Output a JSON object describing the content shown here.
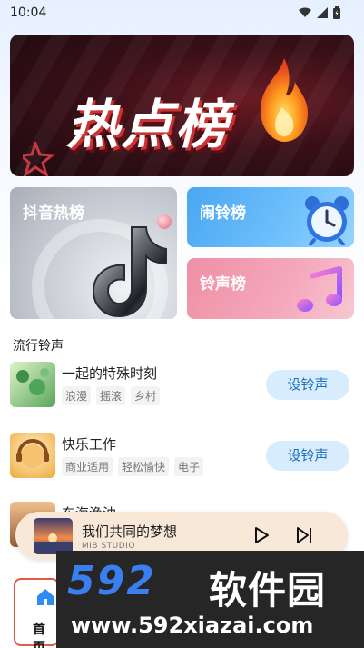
{
  "status_bar": {
    "time": "10:04"
  },
  "banner": {
    "title": "热点榜"
  },
  "cards": {
    "douyin": {
      "label": "抖音热榜"
    },
    "alarm": {
      "label": "闹铃榜"
    },
    "ringtone": {
      "label": "铃声榜"
    }
  },
  "section": {
    "title": "流行铃声"
  },
  "songs": [
    {
      "name": "一起的特殊时刻",
      "tags": [
        "浪漫",
        "摇滚",
        "乡村"
      ],
      "action": "设铃声"
    },
    {
      "name": "快乐工作",
      "tags": [
        "商业适用",
        "轻松愉快",
        "电子"
      ],
      "action": "设铃声"
    },
    {
      "name": "东海渔油"
    }
  ],
  "player": {
    "track": "我们共同的梦想",
    "artist": "MIB STUDIO"
  },
  "nav": {
    "home": "首页"
  },
  "watermark": {
    "brand": "592",
    "brand_cn": "软件园",
    "url": "www.592xiazai.com"
  },
  "colors": {
    "accent": "#1f6fbf",
    "button_bg": "#d7ecfc",
    "nav_border": "#e05a44"
  }
}
